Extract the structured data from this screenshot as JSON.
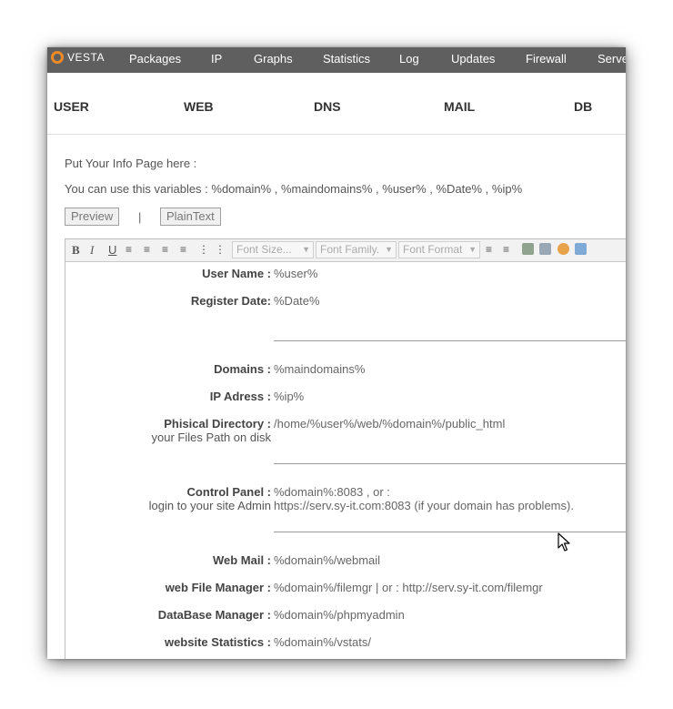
{
  "nav": {
    "logo": "VESTA",
    "items": [
      "Packages",
      "IP",
      "Graphs",
      "Statistics",
      "Log",
      "Updates",
      "Firewall",
      "Server"
    ]
  },
  "subnav": [
    "USER",
    "WEB",
    "DNS",
    "MAIL",
    "DB"
  ],
  "info": {
    "line1": "Put Your Info Page here :",
    "line2": "You can use this variables : %domain% , %maindomains% , %user% , %Date% , %ip%"
  },
  "buttons": {
    "preview": "Preview",
    "separator": "|",
    "plaintext": "PlainText"
  },
  "toolbar": {
    "bold": "B",
    "italic": "I",
    "underline": "U",
    "font_size": "Font Size...",
    "font_family": "Font Family.",
    "font_format": "Font Format"
  },
  "content": [
    {
      "label": "User Name :",
      "value": "%user%"
    },
    {
      "label": "Register Date:",
      "value": "%Date%"
    },
    {
      "label": "Domains :",
      "value": "%maindomains%"
    },
    {
      "label": "IP Adress :",
      "value": "%ip%"
    },
    {
      "label": "Phisical Directory :",
      "sub": "your Files Path on disk",
      "value": "/home/%user%/web/%domain%/public_html"
    },
    {
      "label": "Control Panel :",
      "sub": "login to your site Admin",
      "value": "%domain%:8083 , or :",
      "value2": "https://serv.sy-it.com:8083 (if your domain has problems)."
    },
    {
      "label": "Web Mail :",
      "value": "%domain%/webmail"
    },
    {
      "label": "web File Manager :",
      "value": "%domain%/filemgr | or : http://serv.sy-it.com/filemgr"
    },
    {
      "label": "DataBase Manager :",
      "value": "%domain%/phpmyadmin"
    },
    {
      "label": "website Statistics :",
      "value": "%domain%/vstats/"
    }
  ]
}
